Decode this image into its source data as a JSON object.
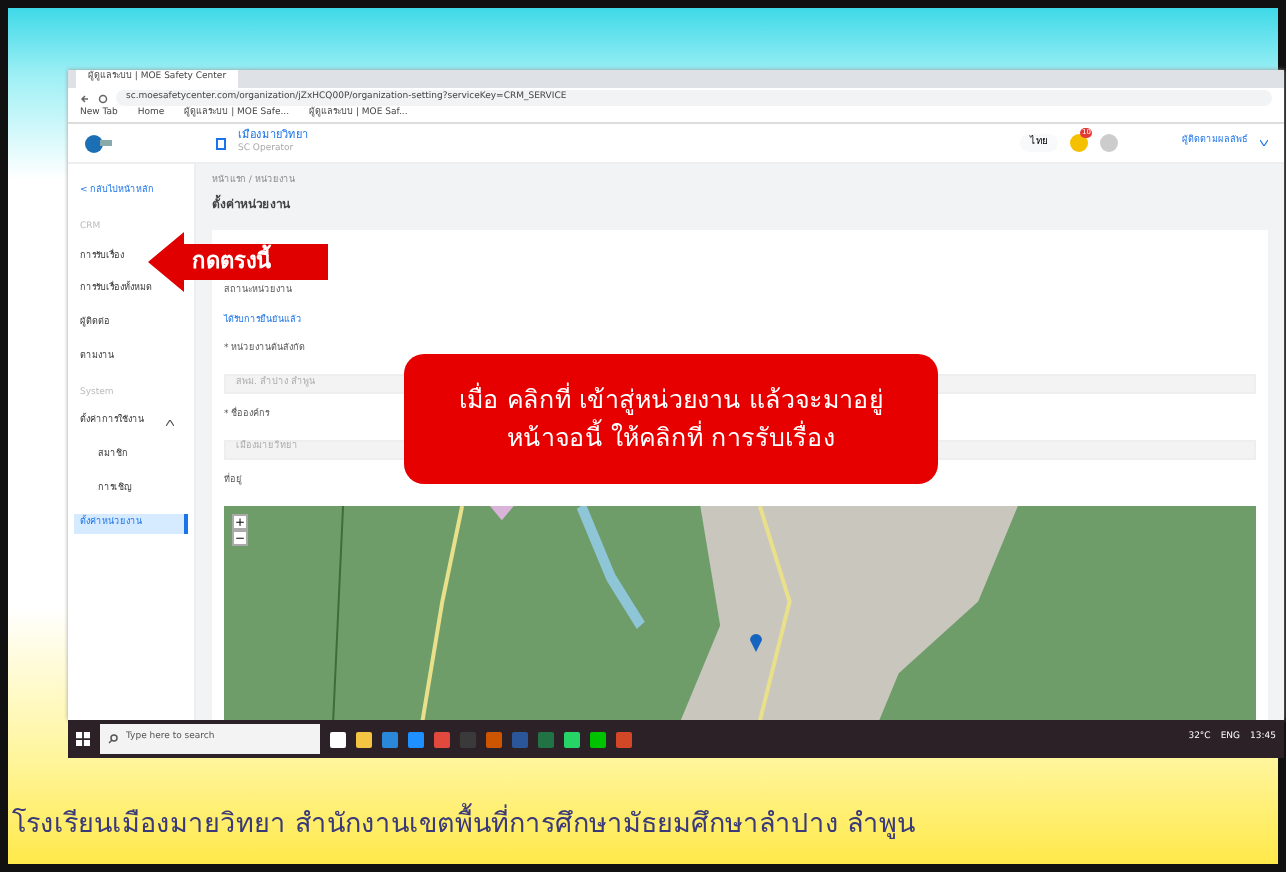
{
  "browser": {
    "tab_title": "ผู้ดูแลระบบ | MOE Safety Center",
    "url": "sc.moesafetycenter.com/organization/jZxHCQ00P/organization-setting?serviceKey=CRM_SERVICE",
    "bookmarks": [
      "New Tab",
      "Home",
      "ผู้ดูแลระบบ | MOE Safe...",
      "ผู้ดูแลระบบ | MOE Saf..."
    ]
  },
  "header": {
    "org_name": "เมืองมายวิทยา",
    "role": "SC Operator",
    "language": "ไทย",
    "notification_count": "10",
    "user": "ผู้ติดตามผลลัพธ์"
  },
  "sidebar": {
    "back": "< กลับไปหน้าหลัก",
    "items": [
      {
        "kind": "section",
        "label": "CRM"
      },
      {
        "kind": "item",
        "label": "การรับเรื่อง",
        "selected": false
      },
      {
        "kind": "item",
        "label": "การรับเรื่องทั้งหมด",
        "selected": false
      },
      {
        "kind": "item",
        "label": "ผู้ติดต่อ",
        "selected": false
      },
      {
        "kind": "item",
        "label": "ตามงาน",
        "selected": false
      },
      {
        "kind": "section",
        "label": "System"
      },
      {
        "kind": "group",
        "label": "ตั้งค่าการใช้งาน",
        "expanded": true
      },
      {
        "kind": "sub",
        "label": "สมาชิก",
        "selected": false
      },
      {
        "kind": "sub",
        "label": "การเชิญ",
        "selected": false
      },
      {
        "kind": "item",
        "label": "ตั้งค่าหน่วยงาน",
        "selected": true
      }
    ]
  },
  "breadcrumb": "หน้าแรก / หน่วยงาน",
  "page_title": "ตั้งค่าหน่วยงาน",
  "form": {
    "status_label": "สถานะหน่วยงาน",
    "status_value": "ได้รับการยืนยันแล้ว",
    "fields": [
      {
        "label": "* หน่วยงานต้นสังกัด",
        "value": "สพม. ลำปาง ลำพูน"
      },
      {
        "label": "* ชื่อองค์กร",
        "value": "เมืองมายวิทยา"
      }
    ],
    "address_label": "ที่อยู่"
  },
  "map": {
    "zoom_in": "+",
    "zoom_out": "−"
  },
  "callouts": {
    "arrow_text": "กดตรงนี้",
    "box_lines": [
      "เมื่อ คลิกที่ เข้าสู่หน่วยงาน แล้วจะมาอยู่",
      "หน้าจอนี้ ให้คลิกที่ การรับเรื่อง"
    ]
  },
  "taskbar": {
    "search_placeholder": "Type here to search",
    "weather": "32°C",
    "language": "ENG",
    "time": "13:45"
  },
  "caption": "โรงเรียนเมืองมายวิทยา  สำนักงานเขตพื้นที่การศึกษามัธยมศึกษาลำปาง  ลำพูน"
}
